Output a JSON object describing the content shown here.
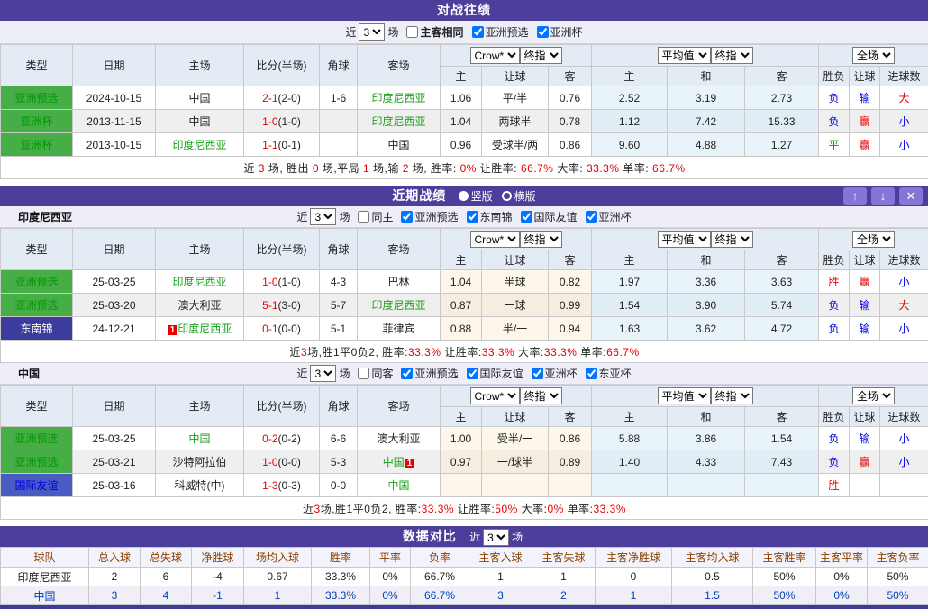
{
  "shared": {
    "main_headers": [
      "类型",
      "日期",
      "主场",
      "比分(半场)",
      "角球",
      "客场"
    ],
    "sub_headers": [
      "主",
      "让球",
      "客",
      "主",
      "和",
      "客",
      "胜负",
      "让球",
      "进球数"
    ],
    "selects": {
      "book": "Crow*",
      "final": "终指",
      "avg": "平均值",
      "scope": "全场"
    }
  },
  "h2h": {
    "title": "对战往绩",
    "filter": {
      "prefix": "近",
      "games": "3",
      "suffix": "场",
      "same_label": "主客相同",
      "leagues": [
        "亚洲预选",
        "亚洲杯"
      ]
    },
    "rows": [
      {
        "type": "亚洲预选",
        "tc": "green",
        "date": "2024-10-15",
        "home": {
          "t": "中国"
        },
        "score": "2-1",
        "half": "(2-0)",
        "corner": "1-6",
        "away": {
          "t": "印度尼西亚",
          "hl": true
        },
        "o": [
          "1.06",
          "平/半",
          "0.76"
        ],
        "a": [
          "2.52",
          "3.19",
          "2.73"
        ],
        "r": [
          {
            "t": "负",
            "c": "blue"
          },
          {
            "t": "输",
            "c": "blue"
          },
          {
            "t": "大",
            "c": "red"
          }
        ]
      },
      {
        "type": "亚洲杯",
        "tc": "green",
        "date": "2013-11-15",
        "home": {
          "t": "中国"
        },
        "score": "1-0",
        "half": "(1-0)",
        "corner": "",
        "away": {
          "t": "印度尼西亚",
          "hl": true
        },
        "o": [
          "1.04",
          "两球半",
          "0.78"
        ],
        "a": [
          "1.12",
          "7.42",
          "15.33"
        ],
        "r": [
          {
            "t": "负",
            "c": "blue"
          },
          {
            "t": "赢",
            "c": "red"
          },
          {
            "t": "小",
            "c": "blue"
          }
        ]
      },
      {
        "type": "亚洲杯",
        "tc": "green",
        "date": "2013-10-15",
        "home": {
          "t": "印度尼西亚",
          "hl": true
        },
        "score": "1-1",
        "half": "(0-1)",
        "corner": "",
        "away": {
          "t": "中国"
        },
        "o": [
          "0.96",
          "受球半/两",
          "0.86"
        ],
        "a": [
          "9.60",
          "4.88",
          "1.27"
        ],
        "r": [
          {
            "t": "平",
            "c": "green"
          },
          {
            "t": "赢",
            "c": "red"
          },
          {
            "t": "小",
            "c": "blue"
          }
        ]
      }
    ],
    "summary": [
      {
        "t": "近 "
      },
      {
        "t": "3",
        "r": true
      },
      {
        "t": " 场, 胜出 "
      },
      {
        "t": "0",
        "r": true
      },
      {
        "t": " 场,平局 "
      },
      {
        "t": "1",
        "r": true
      },
      {
        "t": " 场,输 "
      },
      {
        "t": "2",
        "r": true
      },
      {
        "t": " 场, 胜率: "
      },
      {
        "t": "0%",
        "r": true
      },
      {
        "t": " 让胜率: "
      },
      {
        "t": "66.7%",
        "r": true
      },
      {
        "t": " 大率: "
      },
      {
        "t": "33.3%",
        "r": true
      },
      {
        "t": " 单率: "
      },
      {
        "t": "66.7%",
        "r": true
      }
    ]
  },
  "recent": {
    "title": "近期战绩",
    "radios": [
      {
        "label": "竖版",
        "checked": true
      },
      {
        "label": "横版",
        "checked": false
      }
    ],
    "buttons": [
      {
        "name": "move-up-button",
        "glyph": "↑"
      },
      {
        "name": "move-down-button",
        "glyph": "↓"
      },
      {
        "name": "close-button",
        "glyph": "✕"
      }
    ],
    "teams": [
      {
        "name": "印度尼西亚",
        "filter": {
          "prefix": "近",
          "games": "3",
          "suffix": "场",
          "same_label": "同主",
          "leagues": [
            "亚洲预选",
            "东南锦",
            "国际友谊",
            "亚洲杯"
          ]
        },
        "rows": [
          {
            "type": "亚洲预选",
            "tc": "green",
            "date": "25-03-25",
            "home": {
              "t": "印度尼西亚",
              "hl": true
            },
            "score": "1-0",
            "half": "(1-0)",
            "corner": "4-3",
            "away": {
              "t": "巴林"
            },
            "o": [
              "1.04",
              "半球",
              "0.82"
            ],
            "a": [
              "1.97",
              "3.36",
              "3.63"
            ],
            "r": [
              {
                "t": "胜",
                "c": "red"
              },
              {
                "t": "赢",
                "c": "red"
              },
              {
                "t": "小",
                "c": "blue"
              }
            ]
          },
          {
            "type": "亚洲预选",
            "tc": "green",
            "date": "25-03-20",
            "home": {
              "t": "澳大利亚"
            },
            "score": "5-1",
            "half": "(3-0)",
            "corner": "5-7",
            "away": {
              "t": "印度尼西亚",
              "hl": true
            },
            "o": [
              "0.87",
              "一球",
              "0.99"
            ],
            "a": [
              "1.54",
              "3.90",
              "5.74"
            ],
            "r": [
              {
                "t": "负",
                "c": "blue"
              },
              {
                "t": "输",
                "c": "blue"
              },
              {
                "t": "大",
                "c": "red"
              }
            ]
          },
          {
            "type": "东南锦",
            "tc": "navy",
            "date": "24-12-21",
            "home": {
              "t": "印度尼西亚",
              "hl": true,
              "badge": "1",
              "bpos": "l"
            },
            "score": "0-1",
            "half": "(0-0)",
            "corner": "5-1",
            "away": {
              "t": "菲律宾"
            },
            "o": [
              "0.88",
              "半/一",
              "0.94"
            ],
            "a": [
              "1.63",
              "3.62",
              "4.72"
            ],
            "r": [
              {
                "t": "负",
                "c": "blue"
              },
              {
                "t": "输",
                "c": "blue"
              },
              {
                "t": "小",
                "c": "blue"
              }
            ]
          }
        ],
        "summary": [
          {
            "t": "近"
          },
          {
            "t": "3",
            "r": true
          },
          {
            "t": "场,胜1平0负2, 胜率:"
          },
          {
            "t": "33.3%",
            "r": true
          },
          {
            "t": " 让胜率:"
          },
          {
            "t": "33.3%",
            "r": true
          },
          {
            "t": " 大率:"
          },
          {
            "t": "33.3%",
            "r": true
          },
          {
            "t": " 单率:"
          },
          {
            "t": "66.7%",
            "r": true
          }
        ]
      },
      {
        "name": "中国",
        "filter": {
          "prefix": "近",
          "games": "3",
          "suffix": "场",
          "same_label": "同客",
          "leagues": [
            "亚洲预选",
            "国际友谊",
            "亚洲杯",
            "东亚杯"
          ]
        },
        "rows": [
          {
            "type": "亚洲预选",
            "tc": "green",
            "date": "25-03-25",
            "home": {
              "t": "中国",
              "hl": true
            },
            "score": "0-2",
            "half": "(0-2)",
            "corner": "6-6",
            "away": {
              "t": "澳大利亚"
            },
            "o": [
              "1.00",
              "受半/一",
              "0.86"
            ],
            "a": [
              "5.88",
              "3.86",
              "1.54"
            ],
            "r": [
              {
                "t": "负",
                "c": "blue"
              },
              {
                "t": "输",
                "c": "blue"
              },
              {
                "t": "小",
                "c": "blue"
              }
            ]
          },
          {
            "type": "亚洲预选",
            "tc": "green",
            "date": "25-03-21",
            "home": {
              "t": "沙特阿拉伯"
            },
            "score": "1-0",
            "half": "(0-0)",
            "corner": "5-3",
            "away": {
              "t": "中国",
              "hl": true,
              "badge": "1",
              "bpos": "r"
            },
            "o": [
              "0.97",
              "一/球半",
              "0.89"
            ],
            "a": [
              "1.40",
              "4.33",
              "7.43"
            ],
            "r": [
              {
                "t": "负",
                "c": "blue"
              },
              {
                "t": "赢",
                "c": "red"
              },
              {
                "t": "小",
                "c": "blue"
              }
            ]
          },
          {
            "type": "国际友谊",
            "tc": "blue",
            "date": "25-03-16",
            "home": {
              "t": "科威特(中)"
            },
            "score": "1-3",
            "half": "(0-3)",
            "corner": "0-0",
            "away": {
              "t": "中国",
              "hl": true
            },
            "o": [
              "",
              "",
              ""
            ],
            "a": [
              "",
              "",
              ""
            ],
            "r": [
              {
                "t": "胜",
                "c": "red"
              },
              {
                "t": "",
                "c": ""
              },
              {
                "t": "",
                "c": ""
              }
            ]
          }
        ],
        "summary": [
          {
            "t": "近"
          },
          {
            "t": "3",
            "r": true
          },
          {
            "t": "场,胜1平0负2, 胜率:"
          },
          {
            "t": "33.3%",
            "r": true
          },
          {
            "t": " 让胜率:"
          },
          {
            "t": "50%",
            "r": true
          },
          {
            "t": " 大率:"
          },
          {
            "t": "0%",
            "r": true
          },
          {
            "t": " 单率:"
          },
          {
            "t": "33.3%",
            "r": true
          }
        ]
      }
    ]
  },
  "compare": {
    "title": "数据对比",
    "filter": {
      "prefix": "近",
      "games": "3",
      "suffix": "场"
    },
    "headers": [
      "球队",
      "总入球",
      "总失球",
      "净胜球",
      "场均入球",
      "胜率",
      "平率",
      "负率",
      "主客入球",
      "主客失球",
      "主客净胜球",
      "主客均入球",
      "主客胜率",
      "主客平率",
      "主客负率"
    ],
    "rows": [
      {
        "team": "印度尼西亚",
        "blue": false,
        "vals": [
          "2",
          "6",
          "-4",
          "0.67",
          "33.3%",
          "0%",
          "66.7%",
          "1",
          "1",
          "0",
          "0.5",
          "50%",
          "0%",
          "50%"
        ]
      },
      {
        "team": "中国",
        "blue": true,
        "vals": [
          "3",
          "4",
          "-1",
          "1",
          "33.3%",
          "0%",
          "66.7%",
          "3",
          "2",
          "1",
          "1.5",
          "50%",
          "0%",
          "50%"
        ]
      }
    ]
  },
  "colors": {
    "accent_purple": "#4C3F9C",
    "button_purple": "#8476D6",
    "type_green": "#47AD47",
    "type_navy": "#3C3C9C",
    "type_blue": "#4A5BC4",
    "win_red": "#E60000",
    "lose_blue": "#0000E6",
    "draw_green": "#009900",
    "team_highlight_green": "#1BA01B",
    "compare_header_brown": "#8B4000",
    "compare_row_blue": "#0040C0"
  }
}
